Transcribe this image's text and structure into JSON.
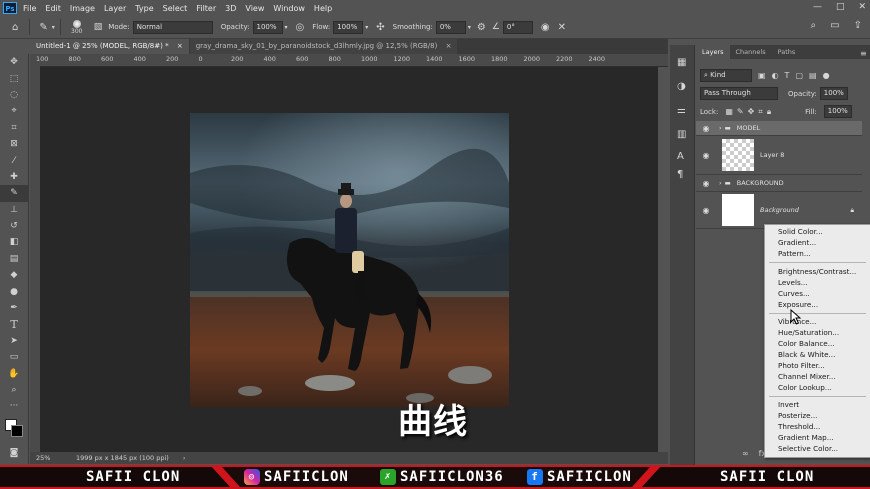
{
  "app": {
    "logo": "Ps"
  },
  "menu": [
    "File",
    "Edit",
    "Image",
    "Layer",
    "Type",
    "Select",
    "Filter",
    "3D",
    "View",
    "Window",
    "Help"
  ],
  "window_controls": [
    "—",
    "□",
    "✕"
  ],
  "options": {
    "brush_size": "300",
    "mode_label": "Mode:",
    "mode_value": "Normal",
    "opacity_label": "Opacity:",
    "opacity_value": "100%",
    "flow_label": "Flow:",
    "flow_value": "100%",
    "smoothing_label": "Smoothing:",
    "smoothing_value": "0%",
    "angle_value": "0°"
  },
  "tabs": [
    {
      "label": "Untitled-1 @ 25% (MODEL, RGB/8#) *",
      "close": "×"
    },
    {
      "label": "gray_drama_sky_01_by_paranoidstock_d3lhmly.jpg @ 12,5% (RGB/8)",
      "close": "×"
    }
  ],
  "ruler_labels": [
    "100",
    "800",
    "600",
    "400",
    "200",
    "0",
    "200",
    "400",
    "600",
    "800",
    "1000",
    "1200",
    "1400",
    "1600",
    "1800",
    "2000",
    "2200",
    "2400"
  ],
  "status": {
    "zoom": "25%",
    "doc_info": "1999 px x 1845 px (100 ppi)",
    "arrow": "›"
  },
  "panel": {
    "tabs": [
      "Layers",
      "Channels",
      "Paths"
    ],
    "kind_label": "Kind",
    "blend_mode": "Pass Through",
    "opacity_label": "Opacity:",
    "opacity_value": "100%",
    "lock_label": "Lock:",
    "fill_label": "Fill:",
    "fill_value": "100%",
    "layers": [
      {
        "name": "MODEL",
        "type": "group"
      },
      {
        "name": "Layer 8",
        "type": "pixel"
      },
      {
        "name": "BACKGROUND",
        "type": "group"
      },
      {
        "name": "Background",
        "type": "background"
      }
    ]
  },
  "adjustment_menu": {
    "group1": [
      "Solid Color...",
      "Gradient...",
      "Pattern..."
    ],
    "group2": [
      "Brightness/Contrast...",
      "Levels...",
      "Curves...",
      "Exposure..."
    ],
    "group3": [
      "Vibrance...",
      "Hue/Saturation...",
      "Color Balance...",
      "Black & White...",
      "Photo Filter...",
      "Channel Mixer...",
      "Color Lookup..."
    ],
    "group4": [
      "Invert",
      "Posterize...",
      "Threshold...",
      "Gradient Map...",
      "Selective Color..."
    ]
  },
  "subtitle": "曲线",
  "banner": {
    "left_name": "SAFII CLON",
    "instagram": "SAFIICLON",
    "x_handle": "SAFIICLON36",
    "facebook": "SAFIICLON",
    "right_name": "SAFII CLON"
  },
  "colors": {
    "accent": "#31a8ff",
    "banner_red": "#d0141c"
  }
}
